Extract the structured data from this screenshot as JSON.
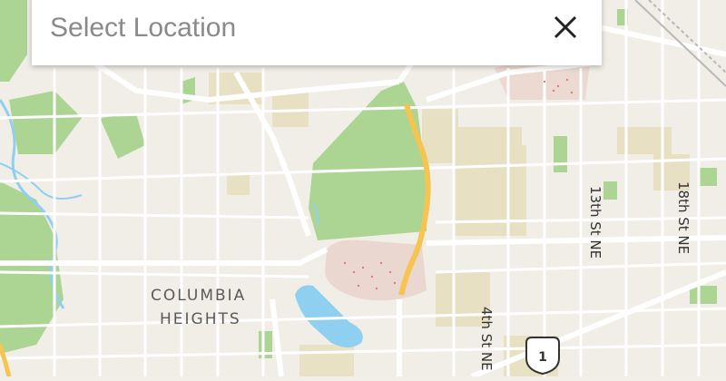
{
  "search": {
    "placeholder": "Select Location"
  },
  "map": {
    "neighborhood_line1": "COLUMBIA",
    "neighborhood_line2": "HEIGHTS",
    "streets": [
      "13th St NE",
      "18th St NE",
      "4th St NE"
    ],
    "route_shield": "1",
    "colors": {
      "park": "#a8d592",
      "water": "#8fd0f0",
      "major_road": "#f5c451",
      "land": "#f2efe9",
      "sand": "#e3d8a8"
    }
  }
}
